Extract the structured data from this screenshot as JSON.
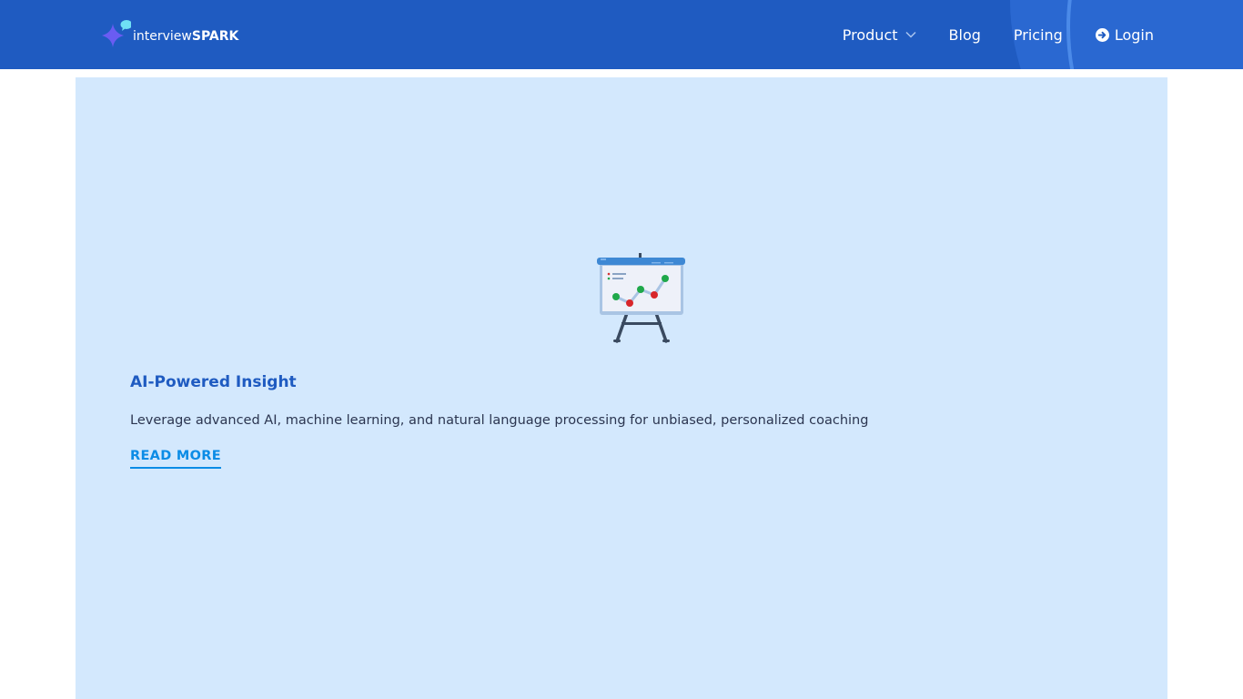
{
  "header": {
    "logo": {
      "text_regular": "interview",
      "text_bold": "SPARK",
      "icon": "sparkle-chat-icon"
    },
    "nav": [
      {
        "label": "Product",
        "icon": "chevron-down-icon"
      },
      {
        "label": "Blog"
      },
      {
        "label": "Pricing"
      },
      {
        "label": "Login",
        "icon": "arrow-circle-right-icon"
      }
    ]
  },
  "feature_card": {
    "icon": "presentation-chart-icon",
    "title": "AI-Powered Insight",
    "description": "Leverage advanced AI, machine learning, and natural language processing for unbiased, personalized coaching",
    "link_label": "READ MORE"
  },
  "colors": {
    "header_bg": "#1f5bc1",
    "card_bg": "#d3e8fd",
    "title": "#1f5bc1",
    "link": "#0b8ce6",
    "text": "#2b3550"
  }
}
